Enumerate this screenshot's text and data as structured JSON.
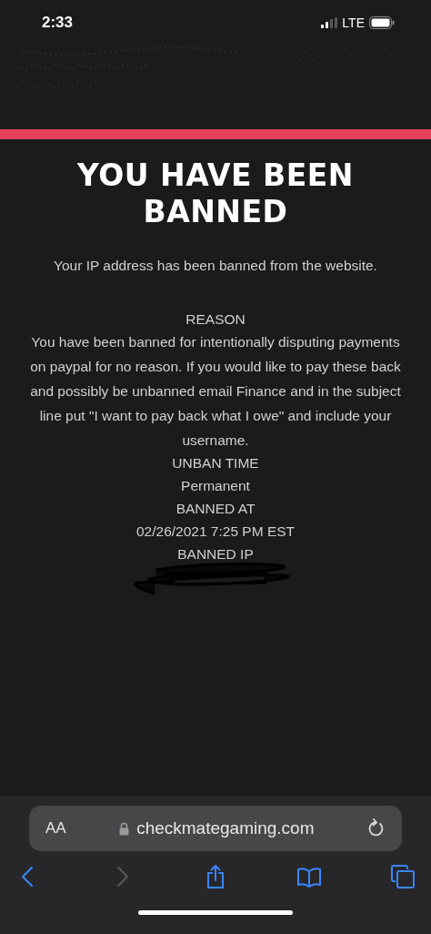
{
  "status_bar": {
    "time": "2:33",
    "network": "LTE"
  },
  "ban": {
    "title": "YOU HAVE BEEN BANNED",
    "intro": "Your IP address has been banned from the website.",
    "details": [
      {
        "kind": "label",
        "text": "REASON"
      },
      {
        "kind": "value",
        "text": "You have been banned for intentionally disputing payments on paypal for no reason. If you would like to pay these back and possibly be unbanned email Finance and in the subject line put \"I want to pay back what I owe\" and include your username."
      },
      {
        "kind": "label",
        "text": "UNBAN TIME"
      },
      {
        "kind": "value",
        "text": "Permanent"
      },
      {
        "kind": "label",
        "text": "BANNED AT"
      },
      {
        "kind": "value",
        "text": "02/26/2021 7:25 PM EST"
      },
      {
        "kind": "label",
        "text": "BANNED IP"
      },
      {
        "kind": "redacted"
      }
    ]
  },
  "browser": {
    "text_size": "AA",
    "url": "checkmategaming.com",
    "toolbar": [
      {
        "kind": "back",
        "disabled": false
      },
      {
        "kind": "forward",
        "disabled": true
      },
      {
        "kind": "share",
        "disabled": false
      },
      {
        "kind": "bookmarks",
        "disabled": false
      },
      {
        "kind": "tabs",
        "disabled": false
      }
    ]
  }
}
